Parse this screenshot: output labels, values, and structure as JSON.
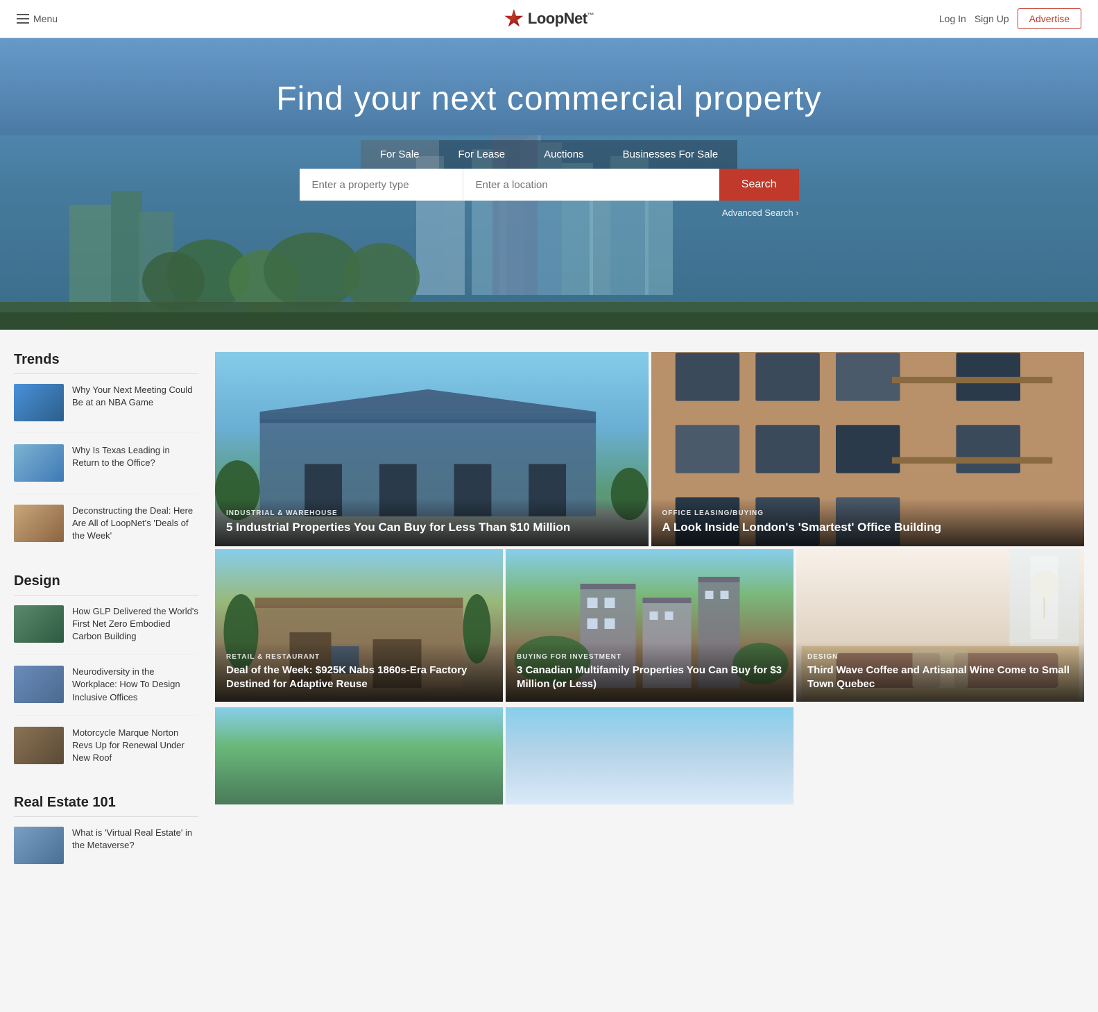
{
  "header": {
    "menu_label": "Menu",
    "logo_name": "LoopNet",
    "logo_tm": "™",
    "login_label": "Log In",
    "signup_label": "Sign Up",
    "advertise_label": "Advertise"
  },
  "hero": {
    "title": "Find your next commercial property",
    "tabs": [
      {
        "label": "For Sale",
        "active": true
      },
      {
        "label": "For Lease",
        "active": false
      },
      {
        "label": "Auctions",
        "active": false
      },
      {
        "label": "Businesses For Sale",
        "active": false
      }
    ],
    "property_placeholder": "Enter a property type",
    "location_placeholder": "Enter a location",
    "search_label": "Search",
    "advanced_search_label": "Advanced Search ›"
  },
  "sidebar": {
    "sections": [
      {
        "title": "Trends",
        "items": [
          {
            "title": "Why Your Next Meeting Could Be at an NBA Game",
            "thumb": "thumb-blue"
          },
          {
            "title": "Why Is Texas Leading in Return to the Office?",
            "thumb": "thumb-city"
          },
          {
            "title": "Deconstructing the Deal: Here Are All of LoopNet's 'Deals of the Week'",
            "thumb": "thumb-building"
          }
        ]
      },
      {
        "title": "Design",
        "items": [
          {
            "title": "How GLP Delivered the World's First Net Zero Embodied Carbon Building",
            "thumb": "thumb-industrial"
          },
          {
            "title": "Neurodiversity in the Workplace: How To Design Inclusive Offices",
            "thumb": "thumb-office"
          },
          {
            "title": "Motorcycle Marque Norton Revs Up for Renewal Under New Roof",
            "thumb": "thumb-motorcycle"
          }
        ]
      },
      {
        "title": "Real Estate 101",
        "items": [
          {
            "title": "What is 'Virtual Real Estate' in the Metaverse?",
            "thumb": "thumb-vr"
          }
        ]
      }
    ]
  },
  "articles": {
    "top_left": {
      "category": "INDUSTRIAL & WAREHOUSE",
      "title": "5 Industrial Properties You Can Buy for Less Than $10 Million",
      "bg": "bg-industrial"
    },
    "top_right": {
      "category": "OFFICE LEASING/BUYING",
      "title": "A Look Inside London's 'Smartest' Office Building",
      "bg": "bg-office-london"
    },
    "bottom": [
      {
        "category": "RETAIL & RESTAURANT",
        "title": "Deal of the Week: $925K Nabs 1860s-Era Factory Destined for Adaptive Reuse",
        "bg": "bg-retail"
      },
      {
        "category": "BUYING FOR INVESTMENT",
        "title": "3 Canadian Multifamily Properties You Can Buy for $3 Million (or Less)",
        "bg": "bg-investment"
      },
      {
        "category": "DESIGN",
        "title": "Third Wave Coffee and Artisanal Wine Come to Small Town Quebec",
        "bg": "bg-design"
      }
    ],
    "extra_bottom": [
      {
        "bg": "bg-bottom-left"
      },
      {
        "bg": "bg-bottom-right"
      }
    ]
  }
}
